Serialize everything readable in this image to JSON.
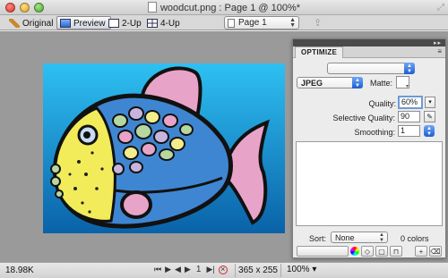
{
  "window": {
    "title": "woodcut.png : Page 1 @ 100%*"
  },
  "toolbar": {
    "tabs": [
      {
        "label": "Original",
        "icon": "pencil-icon",
        "active": false
      },
      {
        "label": "Preview",
        "icon": "preview-icon",
        "active": true
      },
      {
        "label": "2-Up",
        "icon": "two-up-icon",
        "active": false
      },
      {
        "label": "4-Up",
        "icon": "four-up-icon",
        "active": false
      }
    ],
    "page_select": "Page 1"
  },
  "status": {
    "file_size": "18.98K",
    "page_number": "1",
    "dimensions": "365 x 255",
    "zoom": "100%"
  },
  "optimize": {
    "panel_title": "OPTIMIZE",
    "preset": "",
    "format": "JPEG",
    "matte_label": "Matte:",
    "quality_label": "Quality:",
    "quality_value": "60%",
    "selective_quality_label": "Selective Quality:",
    "selective_quality_value": "90",
    "smoothing_label": "Smoothing:",
    "smoothing_value": "1",
    "sort_label": "Sort:",
    "sort_value": "None",
    "colors_count": "0 colors"
  },
  "colors": {
    "canvas_bg": "#9a9a9a",
    "image_bg_top": "#2ec0f2",
    "image_bg_bottom": "#0a62a8",
    "fish_blue": "#3f86d2",
    "fish_yellow": "#f2ec5a",
    "fish_pink": "#e8a4c8"
  }
}
